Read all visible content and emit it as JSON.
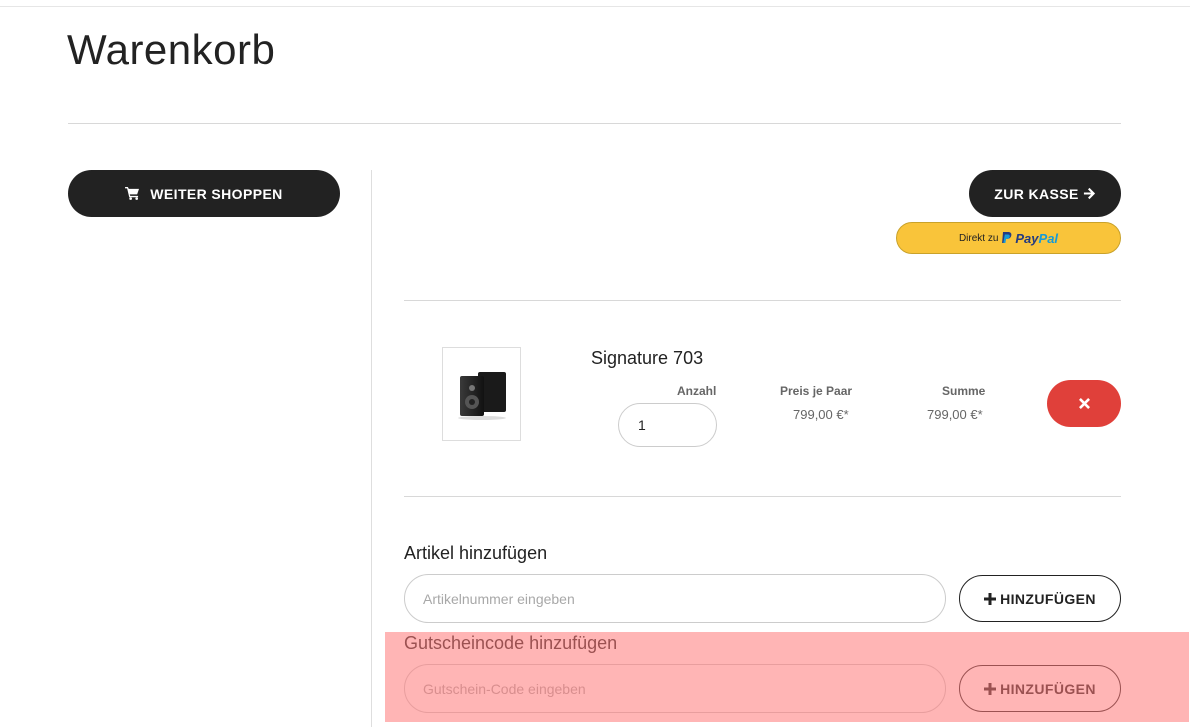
{
  "page": {
    "title": "Warenkorb"
  },
  "actions": {
    "continue_shopping_label": "WEITER SHOPPEN",
    "checkout_label": "ZUR KASSE",
    "paypal_prefix": "Direkt zu",
    "paypal_brand_part1": "Pay",
    "paypal_brand_part2": "Pal"
  },
  "cart": {
    "items": [
      {
        "name": "Signature 703",
        "quantity_label": "Anzahl",
        "quantity": "1",
        "unit_price_label": "Preis je Paar",
        "unit_price": "799,00 €*",
        "total_label": "Summe",
        "total": "799,00 €*"
      }
    ]
  },
  "add_article": {
    "heading": "Artikel hinzufügen",
    "placeholder": "Artikelnummer eingeben",
    "button_label": "HINZUFÜGEN"
  },
  "voucher": {
    "heading": "Gutscheincode hinzufügen",
    "placeholder": "Gutschein-Code eingeben",
    "button_label": "HINZUFÜGEN"
  },
  "colors": {
    "primary": "#222222",
    "danger": "#e0403a",
    "paypal_yellow": "#f9c43a",
    "highlight": "#ff7878"
  },
  "icons": {
    "continue_shopping": "cart-icon",
    "checkout": "arrow-right-icon",
    "remove": "close-icon",
    "add": "plus-icon"
  }
}
